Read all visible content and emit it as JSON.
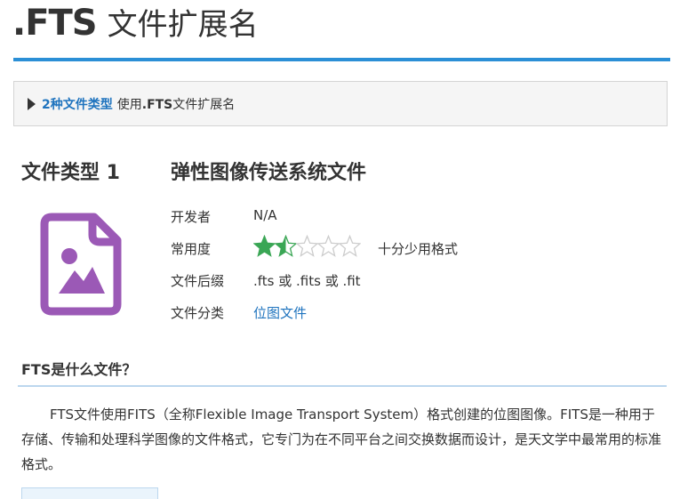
{
  "header": {
    "ext": ".FTS",
    "title_rest": "文件扩展名"
  },
  "types_bar": {
    "link_text": "2种文件类型",
    "prefix": "使用",
    "ext_bold": ".FTS",
    "suffix": "文件扩展名"
  },
  "file_type": {
    "label": "文件类型 1",
    "name": "弹性图像传送系统文件",
    "icon": "image-file-icon",
    "icon_color": "#9b59b6",
    "rows": {
      "developer": {
        "label": "开发者",
        "value": "N/A"
      },
      "popularity": {
        "label": "常用度",
        "rating": 1.5,
        "max": 5,
        "text": "十分少用格式"
      },
      "extensions": {
        "label": "文件后缀",
        "value": ".fts 或 .fits 或 .fit"
      },
      "category": {
        "label": "文件分类",
        "value": "位图文件"
      }
    }
  },
  "section": {
    "title": "FTS是什么文件？",
    "paragraph": "FTS文件使用FITS（全称Flexible Image Transport System）格式创建的位图图像。FITS是一种用于存储、传输和处理科学图像的文件格式，它专门为在不同平台之间交换数据而设计，是天文学中最常用的标准格式。"
  },
  "colors": {
    "accent": "#2b8fd6",
    "link": "#1e73be",
    "star_fill": "#3aa655",
    "star_empty": "#cccccc"
  }
}
